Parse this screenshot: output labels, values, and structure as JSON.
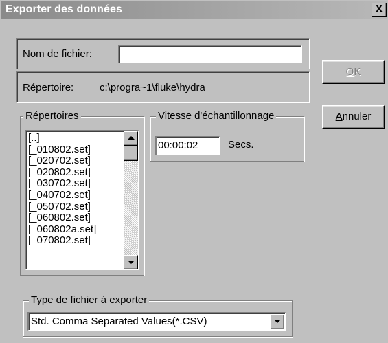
{
  "window": {
    "title": "Exporter des données",
    "close_glyph": "X"
  },
  "filename": {
    "label_accel": "N",
    "label_rest": "om de fichier:",
    "value": ""
  },
  "directory": {
    "label": "Répertoire:",
    "path": "c:\\progra~1\\fluke\\hydra"
  },
  "directories_group": {
    "legend_accel": "R",
    "legend_rest": "épertoires",
    "items": [
      "[..]",
      "[_010802.set]",
      "[_020702.set]",
      "[_020802.set]",
      "[_030702.set]",
      "[_040702.set]",
      "[_050702.set]",
      "[_060802.set]",
      "[_060802a.set]",
      "[_070802.set]"
    ]
  },
  "sample_rate_group": {
    "legend_accel": "V",
    "legend_rest": "itesse d'échantillonnage",
    "value": "00:00:02",
    "unit": "Secs."
  },
  "buttons": {
    "ok_accel": "O",
    "ok_rest": "K",
    "ok_enabled": false,
    "cancel_accel": "A",
    "cancel_rest": "nnuler"
  },
  "filetype_group": {
    "legend": "Type de fichier à exporter",
    "selected": "Std. Comma Separated Values(*.CSV)"
  }
}
